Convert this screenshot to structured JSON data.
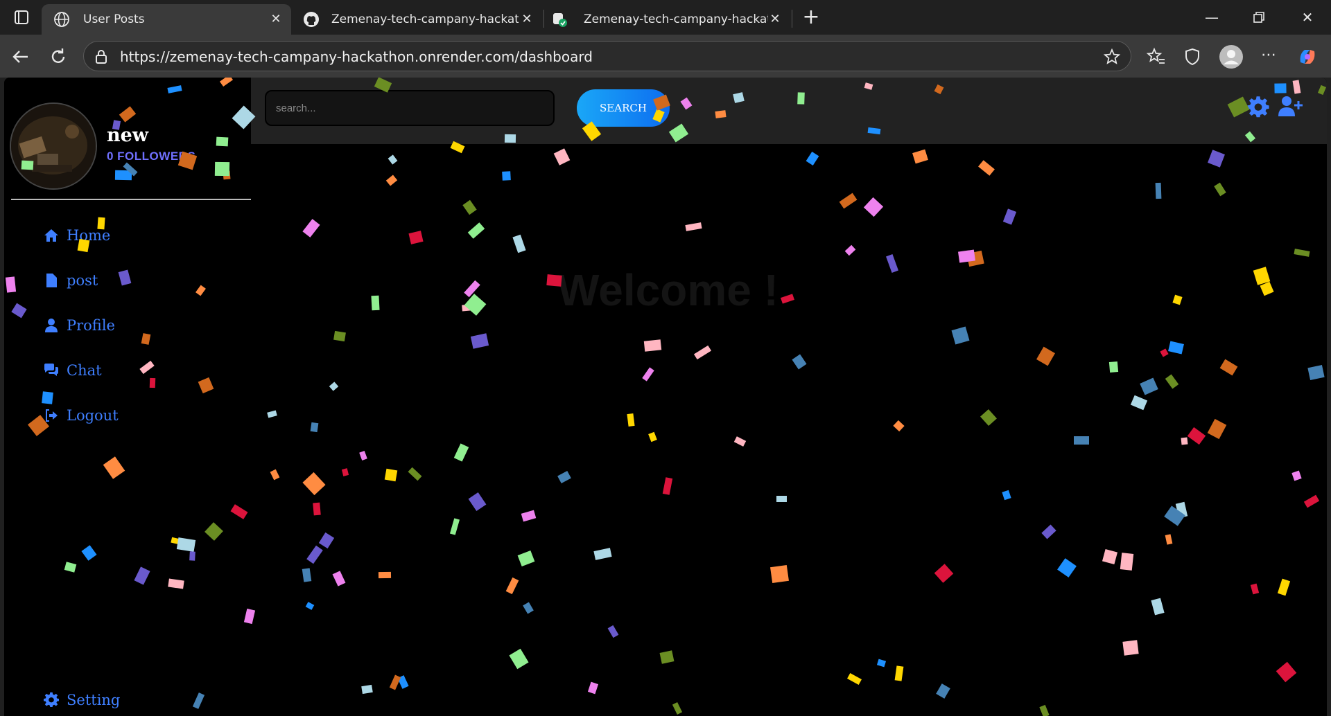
{
  "browser": {
    "tabs": [
      {
        "title": "User Posts",
        "icon": "globe-icon",
        "active": true
      },
      {
        "title": "Zemenay-tech-campany-hackath",
        "icon": "github-icon",
        "active": false
      },
      {
        "title": "Zemenay-tech-campany-hackath",
        "icon": "render-icon",
        "active": false
      }
    ],
    "url": "https://zemenay-tech-campany-hackathon.onrender.com/dashboard"
  },
  "profile": {
    "username": "new",
    "followers": "0 FOLLOWERS"
  },
  "sidebar": {
    "items": [
      {
        "label": "Home",
        "icon": "home-icon"
      },
      {
        "label": "post",
        "icon": "file-icon"
      },
      {
        "label": "Profile",
        "icon": "user-icon"
      },
      {
        "label": "Chat",
        "icon": "comments-icon"
      },
      {
        "label": "Logout",
        "icon": "logout-icon"
      }
    ],
    "settings_label": "Setting"
  },
  "topbar": {
    "search_placeholder": "search...",
    "search_button": "SEARCH"
  },
  "main": {
    "welcome": "Welcome !"
  },
  "colors": {
    "accent": "#3f7fff",
    "followers": "#7070ff",
    "search_button": "#0d8af2",
    "confetti": [
      "#ffd700",
      "#90ee90",
      "#ff8c42",
      "#dc143c",
      "#add8e6",
      "#ee82ee",
      "#6a5acd",
      "#4682b4",
      "#ffb6c1",
      "#6b8e23",
      "#1e90ff",
      "#d2691e"
    ]
  }
}
